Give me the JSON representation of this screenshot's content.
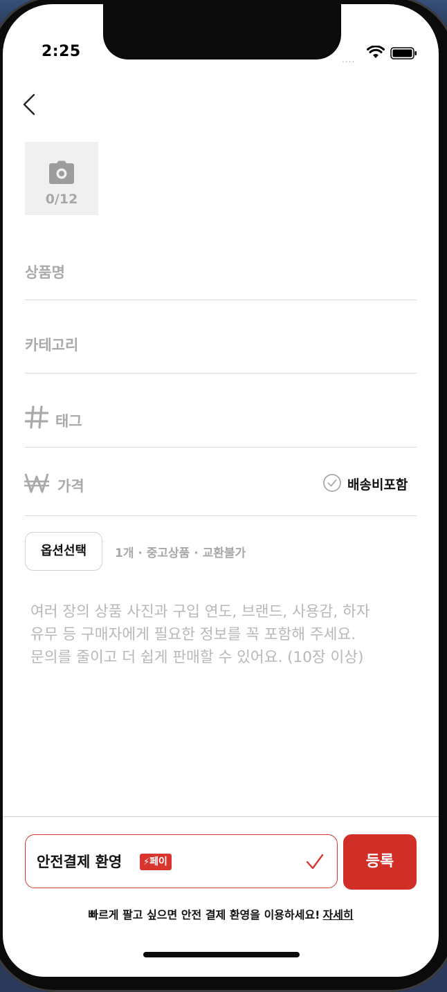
{
  "status_bar": {
    "time": "2:25",
    "signal": "....",
    "wifi_icon": "wifi-icon",
    "battery_icon": "battery-icon"
  },
  "header": {
    "back_icon": "chevron-left-icon"
  },
  "photo": {
    "icon": "camera-icon",
    "count": "0/12"
  },
  "form": {
    "name_placeholder": "상품명",
    "category_placeholder": "카테고리",
    "tag_icon": "hash-icon",
    "tag_placeholder": "태그",
    "price_icon": "won-icon",
    "price_placeholder": "가격",
    "shipping_included_label": "배송비포함",
    "shipping_included_checked": false
  },
  "options": {
    "button_label": "옵션선택",
    "summary": "1개 · 중고상품 · 교환불가"
  },
  "description": {
    "placeholder_lines": [
      "여러 장의 상품 사진과 구입 연도, 브랜드, 사용감, 하자",
      "유무 등 구매자에게 필요한 정보를 꼭 포함해 주세요.",
      "문의를 줄이고 더 쉽게 판매할 수 있어요. (10장 이상)"
    ]
  },
  "footer": {
    "safe_pay_label": "안전결제 환영",
    "pay_badge": "페이",
    "safe_pay_checked": true,
    "register_label": "등록",
    "note": "빠르게 팔고 싶으면 안전 결제 환영을 이용하세요!",
    "note_link": "자세히"
  },
  "colors": {
    "accent": "#d12e27",
    "placeholder": "#a9a9a9",
    "divider": "#d6d6d6"
  }
}
